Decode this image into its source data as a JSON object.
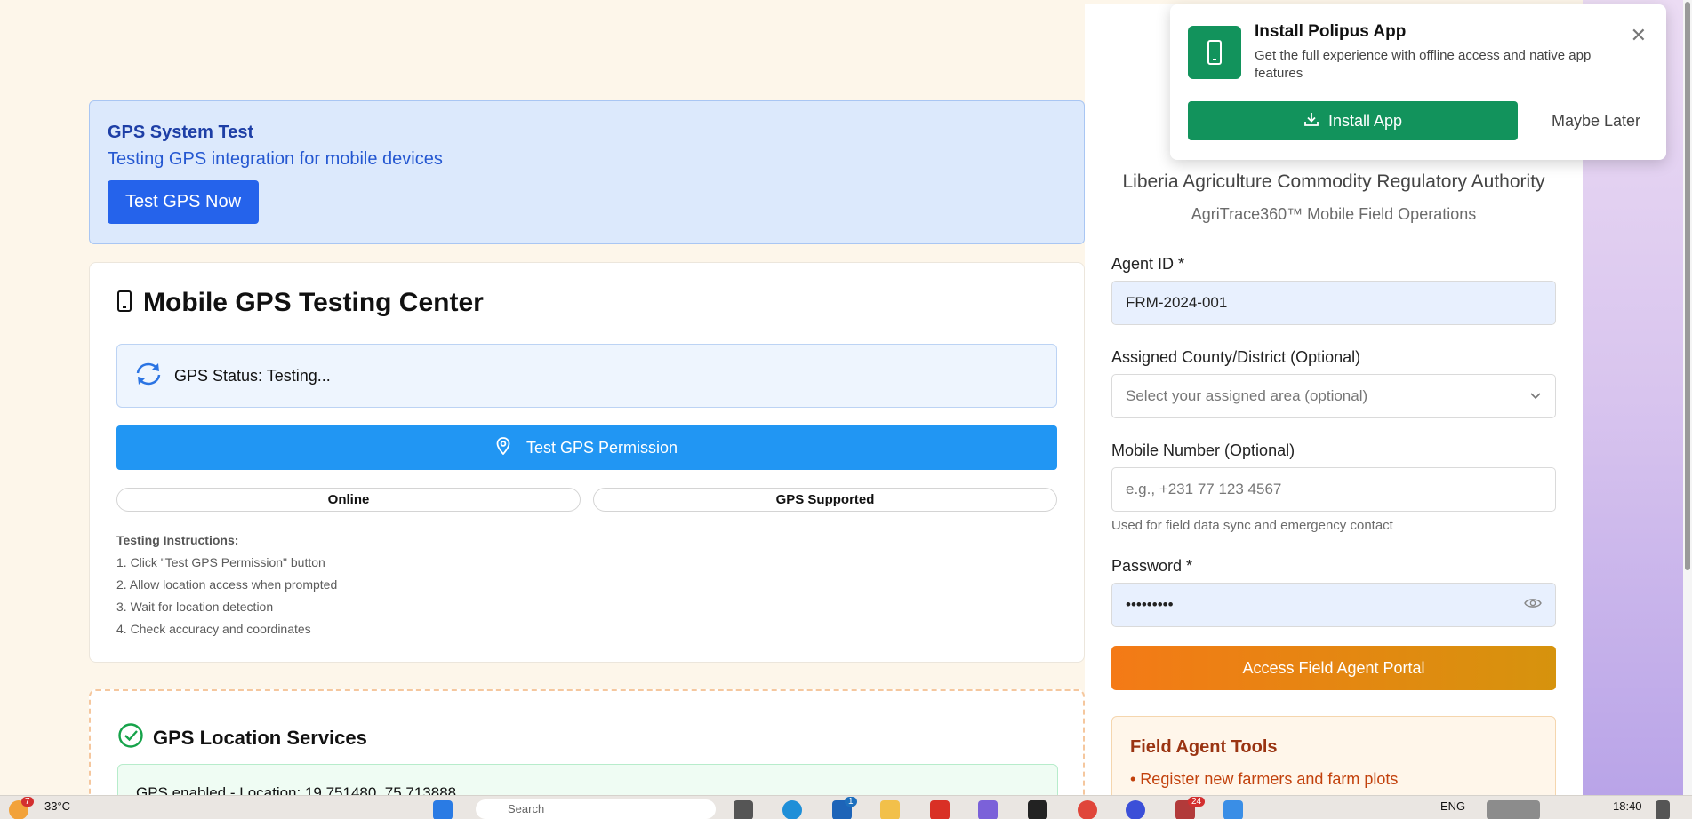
{
  "gps_test": {
    "title": "GPS System Test",
    "subtitle": "Testing GPS integration for mobile devices",
    "button": "Test GPS Now"
  },
  "testing_center": {
    "title": "Mobile GPS Testing Center",
    "status": "GPS Status: Testing...",
    "button": "Test GPS Permission",
    "pill_online": "Online",
    "pill_gps": "GPS Supported",
    "instructions_title": "Testing Instructions:",
    "instructions": [
      "1. Click \"Test GPS Permission\" button",
      "2. Allow location access when prompted",
      "3. Wait for location detection",
      "4. Check accuracy and coordinates"
    ]
  },
  "location_services": {
    "title": "GPS Location Services",
    "message": "GPS enabled - Location: 19.751480, 75.713888"
  },
  "login": {
    "org": "Liberia Agriculture Commodity Regulatory Authority",
    "subtitle": "AgriTrace360™ Mobile Field Operations",
    "agent_id_label": "Agent ID *",
    "agent_id_value": "FRM-2024-001",
    "county_label": "Assigned County/District (Optional)",
    "county_placeholder": "Select your assigned area (optional)",
    "mobile_label": "Mobile Number (Optional)",
    "mobile_placeholder": "e.g., +231 77 123 4567",
    "mobile_hint": "Used for field data sync and emergency contact",
    "password_label": "Password *",
    "password_value": "•••••••••",
    "submit": "Access Field Agent Portal",
    "tools_title": "Field Agent Tools",
    "tools_items": [
      "• Register new farmers and farm plots"
    ]
  },
  "popup": {
    "title": "Install Polipus App",
    "desc": "Get the full experience with offline access and native app features",
    "install": "Install App",
    "later": "Maybe Later"
  },
  "taskbar": {
    "weather": "33°C",
    "weather_badge": "7",
    "search": "Search",
    "lang": "ENG",
    "time": "18:40",
    "badge_mail": "1",
    "badge_app": "24"
  },
  "colors": {
    "accent_blue": "#2563eb",
    "gps_blue": "#2196f3",
    "green": "#12935c",
    "orange": "#f47a16"
  }
}
